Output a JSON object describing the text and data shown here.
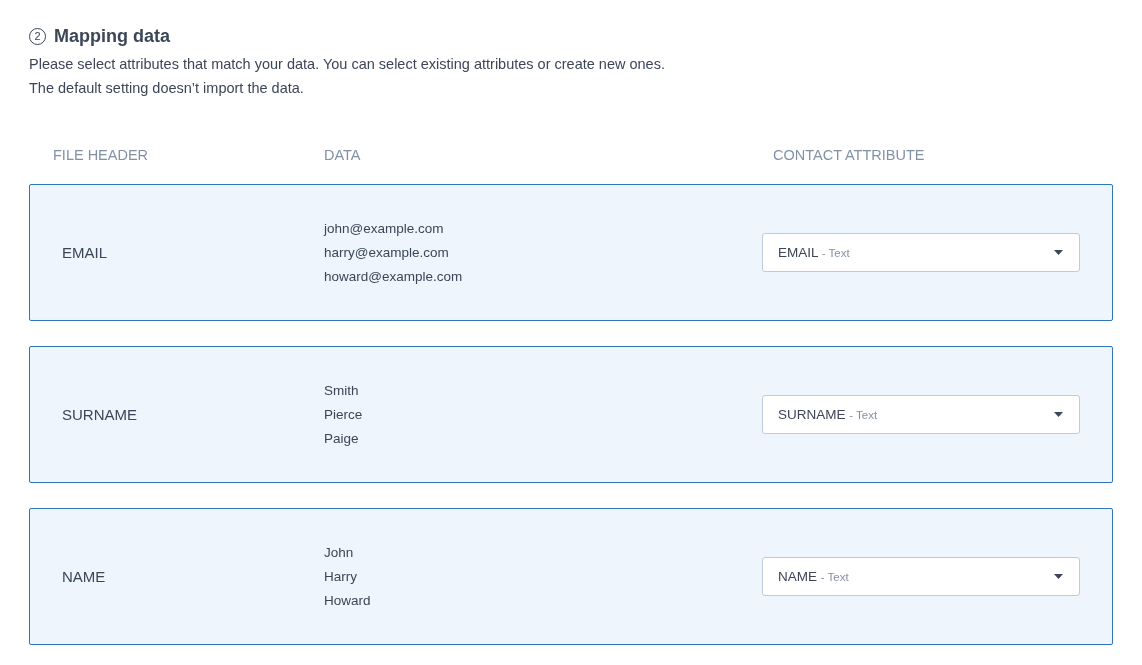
{
  "section": {
    "step": "2",
    "title": "Mapping data",
    "description": [
      "Please select attributes that match your data. You can select existing attributes or create new ones.",
      "The default setting doesn’t import the data."
    ]
  },
  "columns": [
    "FILE HEADER",
    "DATA",
    "CONTACT ATTRIBUTE"
  ],
  "rows": [
    {
      "header": "EMAIL",
      "data": [
        "john@example.com",
        "harry@example.com",
        "howard@example.com"
      ],
      "attribute": {
        "name": "EMAIL",
        "separator": "-",
        "type": "Text"
      }
    },
    {
      "header": "SURNAME",
      "data": [
        "Smith",
        "Pierce",
        "Paige"
      ],
      "attribute": {
        "name": "SURNAME",
        "separator": "-",
        "type": "Text"
      }
    },
    {
      "header": "NAME",
      "data": [
        "John",
        "Harry",
        "Howard"
      ],
      "attribute": {
        "name": "NAME",
        "separator": "-",
        "type": "Text"
      }
    }
  ]
}
